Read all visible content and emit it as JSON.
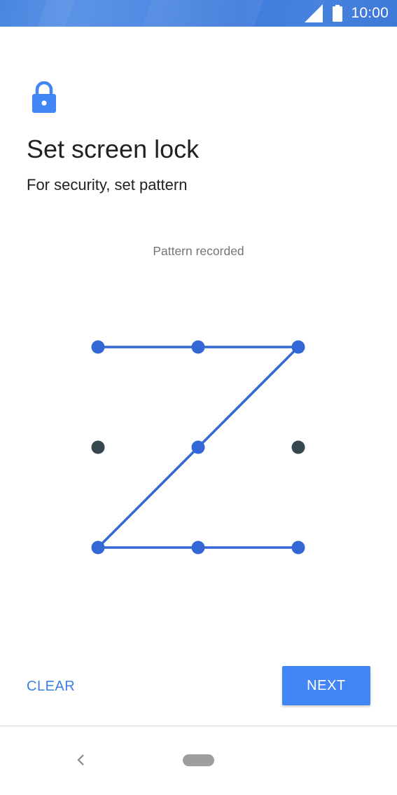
{
  "status_bar": {
    "time": "10:00",
    "icons": [
      "signal-icon",
      "battery-icon"
    ],
    "color": "#4a86e0"
  },
  "header": {
    "icon": "lock-icon",
    "title": "Set screen lock",
    "subtitle": "For security, set pattern"
  },
  "pattern": {
    "status": "Pattern recorded",
    "grid": "3x3",
    "selected_sequence": [
      1,
      2,
      3,
      5,
      7,
      8,
      9
    ],
    "active_color": "#3367d6",
    "inactive_color": "#37474f"
  },
  "actions": {
    "clear_label": "CLEAR",
    "next_label": "NEXT",
    "accent": "#4285f4"
  },
  "nav_bar": {
    "icons": [
      "back-icon",
      "home-pill-icon"
    ]
  }
}
